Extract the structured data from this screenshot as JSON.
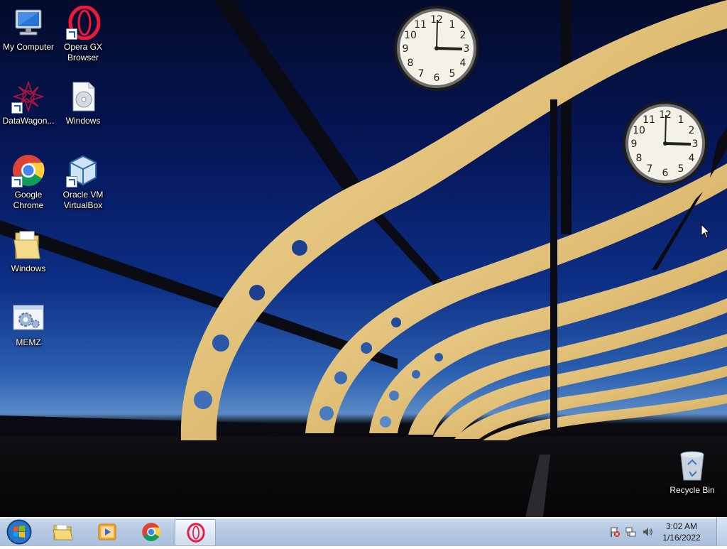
{
  "desktop": {
    "icons": [
      {
        "label": "My Computer",
        "icon": "computer-icon"
      },
      {
        "label": "Opera GX\nBrowser",
        "icon": "opera-gx-icon",
        "shortcut": true
      },
      {
        "label": "DataWagon...",
        "icon": "datawagon-icon",
        "shortcut": true
      },
      {
        "label": "Windows",
        "icon": "disc-image-icon"
      },
      {
        "label": "Google\nChrome",
        "icon": "chrome-icon",
        "shortcut": true
      },
      {
        "label": "Oracle VM\nVirtualBox",
        "icon": "virtualbox-icon",
        "shortcut": true
      },
      {
        "label": "Windows",
        "icon": "folder-icon"
      },
      {
        "label": "MEMZ",
        "icon": "settings-app-icon"
      },
      {
        "label": "Recycle Bin",
        "icon": "recycle-bin-icon"
      }
    ],
    "clock_gadgets": [
      {
        "time": "3:02"
      },
      {
        "time": "3:02"
      }
    ]
  },
  "taskbar": {
    "buttons": [
      {
        "icon": "file-explorer-icon",
        "active": false
      },
      {
        "icon": "media-player-icon",
        "active": false
      },
      {
        "icon": "chrome-icon",
        "active": false
      },
      {
        "icon": "opera-gx-icon",
        "active": true
      }
    ],
    "tray": {
      "icons": [
        "action-center-flag-icon",
        "network-icon",
        "volume-icon"
      ],
      "time": "3:02 AM",
      "date": "1/16/2022"
    }
  },
  "colors": {
    "sky_top": "#030b2a",
    "sky_horizon": "#5a8ac6",
    "bridge_gold": "#e8c47a",
    "taskbar": "#b5c9e2"
  }
}
